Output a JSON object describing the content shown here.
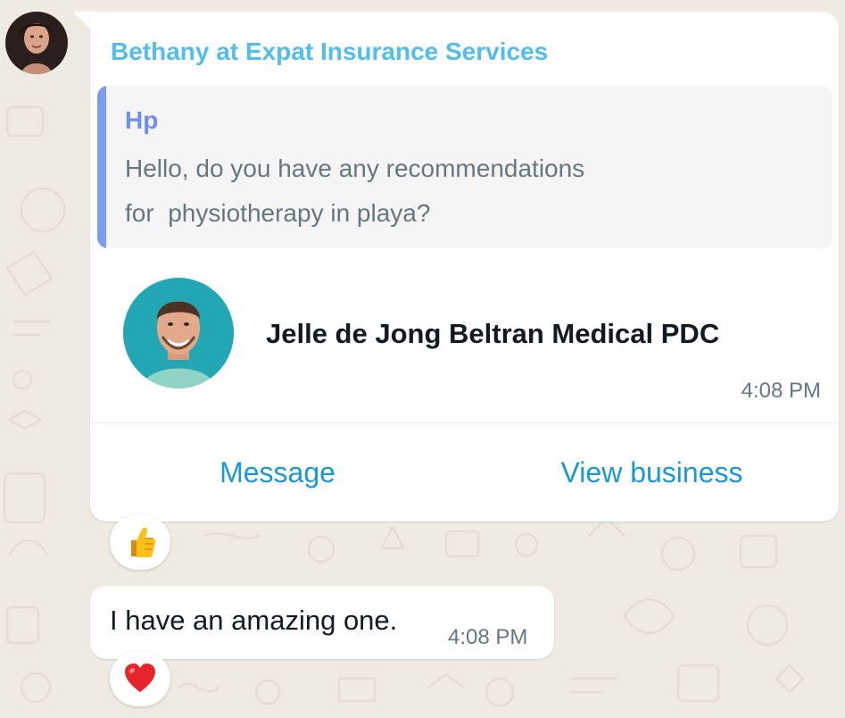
{
  "colors": {
    "background": "#efeae2",
    "sender_name": "#53bdeb",
    "quote_bar": "#7b9cf3",
    "quote_author": "#6f90e8",
    "link": "#1a98d5",
    "time": "#667781"
  },
  "message_1": {
    "sender": "Bethany at Expat Insurance Services",
    "quote": {
      "author": "Hp",
      "lines": [
        "Hello, do you have any recommendations",
        "for  physiotherapy in playa?"
      ]
    },
    "contact_card": {
      "name": "Jelle de Jong Beltran Medical PDC",
      "time": "4:08 PM",
      "actions": {
        "message": "Message",
        "view_business": "View business"
      }
    },
    "reaction": {
      "emoji": "thumbs-up-icon"
    }
  },
  "message_2": {
    "text": "I have an amazing one.",
    "time": "4:08 PM",
    "reaction": {
      "emoji": "red-heart-icon"
    }
  }
}
